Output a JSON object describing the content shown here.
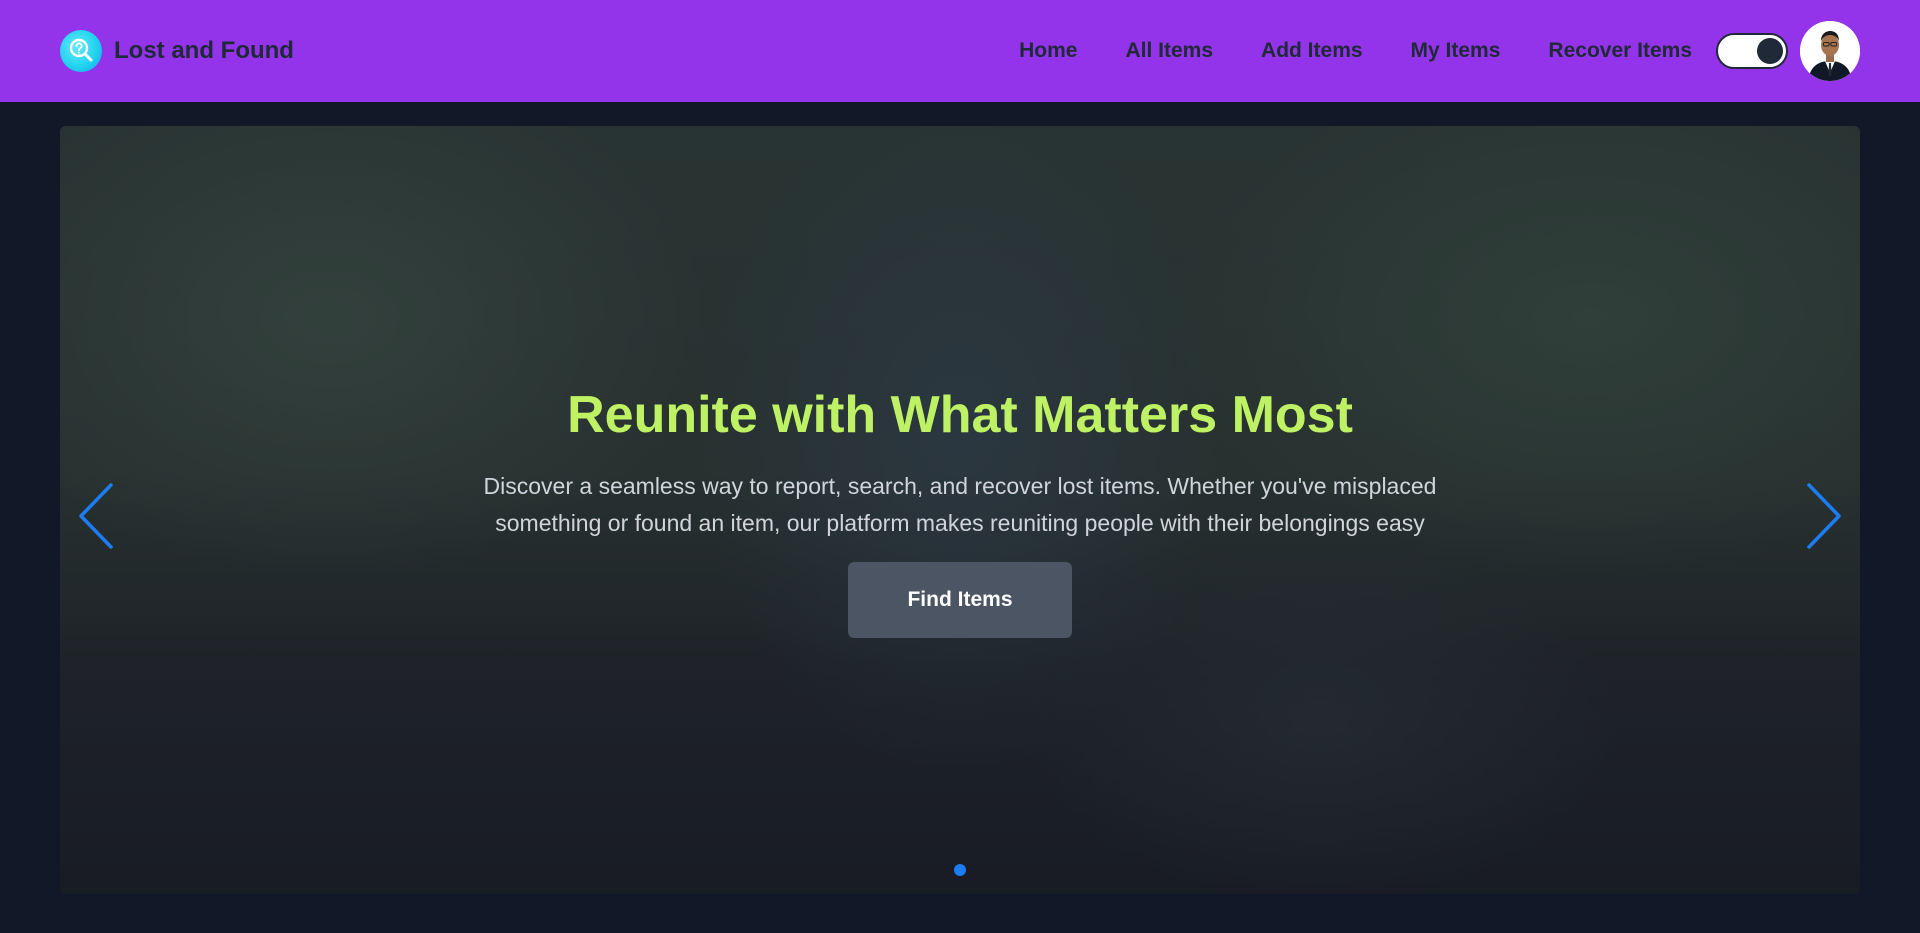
{
  "navbar": {
    "brand_title": "Lost and Found",
    "links": [
      {
        "label": "Home"
      },
      {
        "label": "All Items"
      },
      {
        "label": "Add Items"
      },
      {
        "label": "My Items"
      },
      {
        "label": "Recover Items"
      }
    ],
    "theme_toggle": {
      "state": "on"
    },
    "colors": {
      "background": "#9333ea",
      "text": "#1f2937"
    }
  },
  "hero": {
    "title": "Reunite with What Matters Most",
    "description": "Discover a seamless way to report, search, and recover lost items. Whether you've misplaced something or found an item, our platform makes reuniting people with their belongings easy",
    "button_label": "Find Items",
    "active_slide": 1,
    "slide_count": 1,
    "colors": {
      "title": "#bef264",
      "description": "#d1d5db",
      "button": "#4b5563",
      "arrows": "#1d7cf2"
    }
  },
  "icons": {
    "brand": "search-question-icon",
    "prev": "chevron-left-icon",
    "next": "chevron-right-icon"
  }
}
